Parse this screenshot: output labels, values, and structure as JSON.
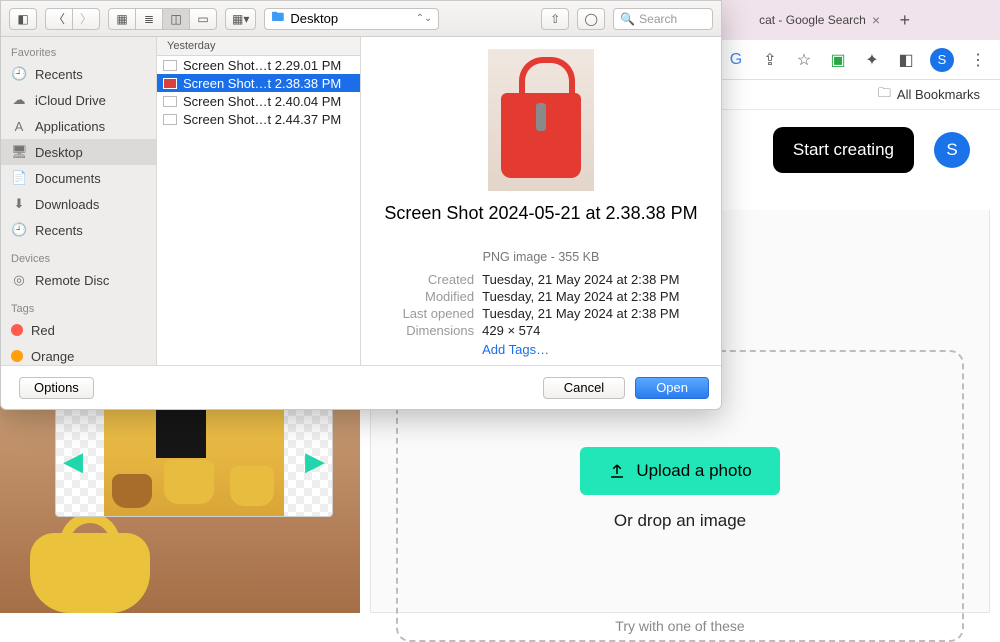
{
  "browser": {
    "tab_title": "cat - Google Search",
    "avatar_letter": "S",
    "all_bookmarks": "All Bookmarks"
  },
  "site": {
    "start_creating": "Start creating",
    "avatar_letter": "S"
  },
  "upload": {
    "button": "Upload a photo",
    "drop_text": "Or drop an image",
    "try_text": "Try with one of these"
  },
  "finder": {
    "location": "Desktop",
    "search_placeholder": "Search",
    "sidebar": {
      "favorites_header": "Favorites",
      "devices_header": "Devices",
      "tags_header": "Tags",
      "favorites": [
        {
          "icon": "🕘",
          "label": "Recents"
        },
        {
          "icon": "☁︎",
          "label": "iCloud Drive"
        },
        {
          "icon": "A",
          "label": "Applications"
        },
        {
          "icon": "🖥",
          "label": "Desktop",
          "selected": true
        },
        {
          "icon": "📄",
          "label": "Documents"
        },
        {
          "icon": "⬇︎",
          "label": "Downloads"
        },
        {
          "icon": "🕘",
          "label": "Recents"
        }
      ],
      "devices": [
        {
          "icon": "◎",
          "label": "Remote Disc"
        }
      ],
      "tags": [
        {
          "color": "#ff5b4f",
          "label": "Red"
        },
        {
          "color": "#ff9f0a",
          "label": "Orange"
        }
      ]
    },
    "filelist": {
      "group": "Yesterday",
      "items": [
        {
          "label": "Screen Shot…t 2.29.01 PM"
        },
        {
          "label": "Screen Shot…t 2.38.38 PM",
          "selected": true
        },
        {
          "label": "Screen Shot…t 2.40.04 PM"
        },
        {
          "label": "Screen Shot…t 2.44.37 PM"
        }
      ]
    },
    "preview": {
      "title": "Screen Shot 2024-05-21 at 2.38.38 PM",
      "meta_line": "PNG image - 355 KB",
      "created_k": "Created",
      "created_v": "Tuesday, 21 May 2024 at 2:38 PM",
      "modified_k": "Modified",
      "modified_v": "Tuesday, 21 May 2024 at 2:38 PM",
      "lastopened_k": "Last opened",
      "lastopened_v": "Tuesday, 21 May 2024 at 2:38 PM",
      "dimensions_k": "Dimensions",
      "dimensions_v": "429 × 574",
      "add_tags": "Add Tags…"
    },
    "footer": {
      "options": "Options",
      "cancel": "Cancel",
      "open": "Open"
    }
  }
}
